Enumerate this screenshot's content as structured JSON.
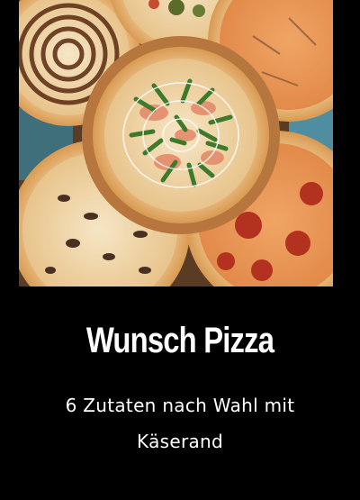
{
  "product": {
    "title": "Wunsch Pizza",
    "description": "6 Zutaten nach Wahl mit Käserand",
    "image_icon": "pizza-photo"
  },
  "colors": {
    "background": "#000000",
    "text": "#ffffff",
    "crust": "#e9b06a",
    "board": "#b7763e"
  }
}
